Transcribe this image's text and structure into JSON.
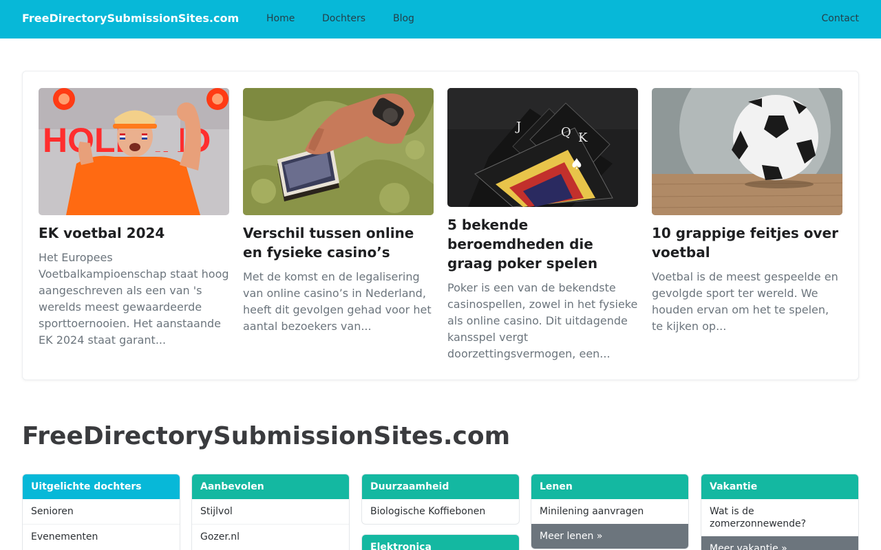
{
  "navbar": {
    "brand": "FreeDirectorySubmissionSites.com",
    "links": [
      "Home",
      "Dochters",
      "Blog"
    ],
    "contact": "Contact"
  },
  "articles": [
    {
      "title": "EK voetbal 2024",
      "excerpt": "Het Europees Voetbalkampioenschap staat hoog aangeschreven als een van 's werelds meest gewaardeerde sporttoernooien. Het aanstaande EK 2024 staat garant...",
      "image": "holland-fan-photo",
      "image_text": "HOLLAND"
    },
    {
      "title": "Verschil tussen online en fysieke casino’s",
      "excerpt": "Met de komst en de legalisering van online casino’s in Nederland, heeft dit gevolgen gehad voor het aantal bezoekers van...",
      "image": "playing-cards-deck-photo"
    },
    {
      "title": "5 bekende beroemdheden die graag poker spelen",
      "excerpt": "Poker is een van de bekendste casinospellen, zowel in het fysieke als online casino. Dit uitdagende kansspel vergt doorzettingsvermogen, een...",
      "image": "poker-cards-photo"
    },
    {
      "title": "10 grappige feitjes over voetbal",
      "excerpt": "Voetbal is de meest gespeelde en gevolgde sport ter wereld. We houden ervan om het te spelen, te kijken op...",
      "image": "football-photo"
    }
  ],
  "site_heading": "FreeDirectorySubmissionSites.com",
  "categories": [
    {
      "title": "Uitgelichte dochters",
      "items": [
        "Senioren",
        "Evenementen"
      ]
    },
    {
      "title": "Aanbevolen",
      "items": [
        "Stijlvol",
        "Gozer.nl"
      ]
    },
    {
      "title": "Duurzaamheid",
      "items": [
        "Biologische Koffiebonen"
      ]
    },
    {
      "title": "Elektronica",
      "items": []
    },
    {
      "title": "Lenen",
      "items": [
        "Minilening aanvragen"
      ],
      "more": "Meer lenen »"
    },
    {
      "title": "Vakantie",
      "items": [
        "Wat is de zomerzonnewende?"
      ],
      "more": "Meer vakantie »"
    }
  ],
  "colors": {
    "navbar": "#07b8d8",
    "category_header_primary": "#07b8d8",
    "category_header_secondary": "#14b8a1",
    "more_button": "#6c757d"
  }
}
